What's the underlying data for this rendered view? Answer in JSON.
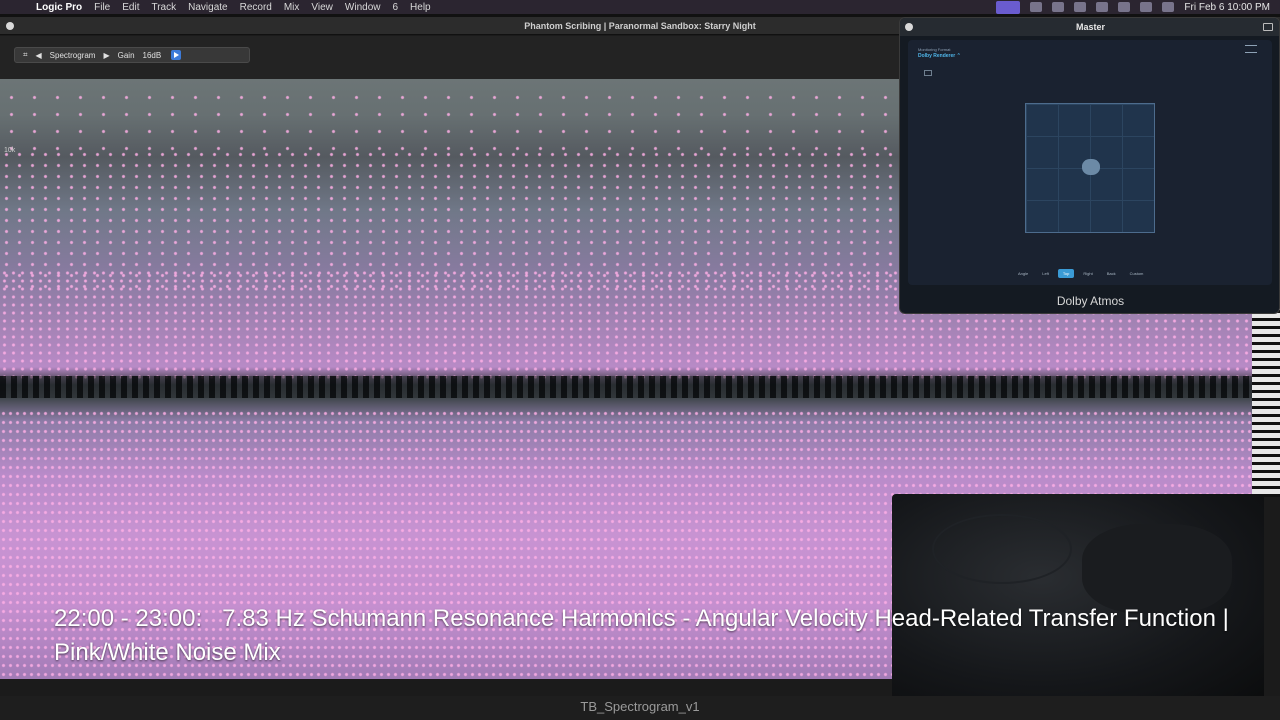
{
  "menubar": {
    "apple": "",
    "app_name": "Logic Pro",
    "items": [
      "File",
      "Edit",
      "Track",
      "Navigate",
      "Record",
      "Mix",
      "View",
      "Window",
      "6",
      "Help"
    ],
    "clock": "Fri Feb 6  10:00 PM"
  },
  "window": {
    "title": "Phantom Scribing | Paranormal Sandbox: Starry Night"
  },
  "plugin": {
    "mode": "Spectrogram",
    "gain_label": "Gain",
    "gain_value": "16dB"
  },
  "spectrogram": {
    "freq_label": "10k"
  },
  "caption": "22:00 - 23:00:   7.83 Hz Schumann Resonance Harmonics - Angular Velocity Head-Related Transfer Function | Pink/White Noise Mix",
  "bottom_label": "TB_Spectrogram_v1",
  "master": {
    "title": "Master",
    "monitoring_format_label": "Monitoring Format",
    "renderer": "Dolby Renderer ⌃",
    "view_tabs": [
      "Angle",
      "Left",
      "Top",
      "Right",
      "Back",
      "Custom"
    ],
    "selected_tab": "Top",
    "footer": "Dolby Atmos"
  },
  "colors": {
    "menubar_bg": "#2b2530",
    "accent_blue": "#3a9bd6",
    "spectro_pink": "#c893d2"
  }
}
